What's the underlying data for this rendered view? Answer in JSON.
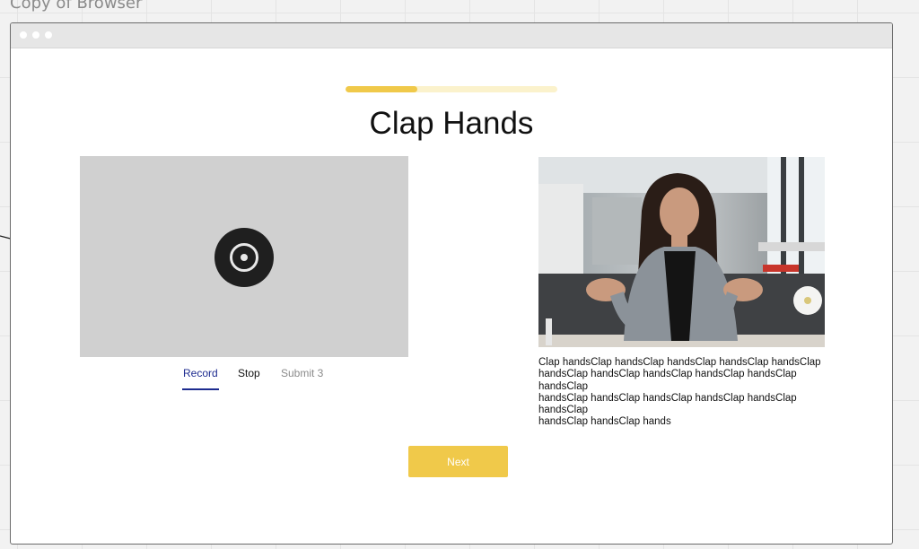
{
  "frame": {
    "title": "Copy of Browser"
  },
  "page": {
    "progress": 0.34,
    "title": "Clap Hands"
  },
  "recorder": {
    "record_label": "Record",
    "stop_label": "Stop",
    "submit_label": "Submit 3"
  },
  "example": {
    "caption": "Clap handsClap handsClap handsClap handsClap handsClap\nhandsClap handsClap handsClap handsClap handsClap\nhandsClap\nhandsClap handsClap handsClap handsClap handsClap\nhandsClap\nhandsClap handsClap hands"
  },
  "actions": {
    "next_label": "Next"
  },
  "colors": {
    "accent": "#f0c94a",
    "accent_light": "#fbf2cc",
    "active_tab": "#1d2b8f",
    "video_placeholder": "#d0d0d0"
  },
  "icons": [
    "record-icon"
  ]
}
